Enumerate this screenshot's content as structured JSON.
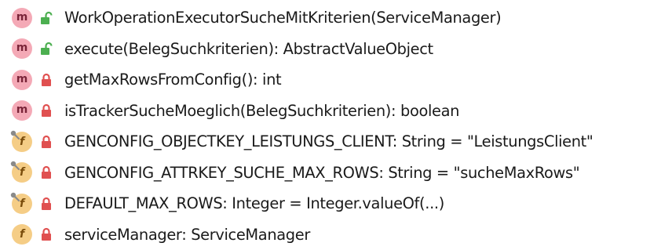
{
  "colors": {
    "method_badge": "#f4a9b6",
    "field_badge": "#f5cd86",
    "public_lock": "#4caf50",
    "private_lock": "#e05050",
    "static_pin": "#8a8a8a"
  },
  "members": [
    {
      "kind": "method",
      "kind_letter": "m",
      "visibility": "public",
      "static": false,
      "text": "WorkOperationExecutorSucheMitKriterien(ServiceManager)"
    },
    {
      "kind": "method",
      "kind_letter": "m",
      "visibility": "public",
      "static": false,
      "text": "execute(BelegSuchkriterien): AbstractValueObject"
    },
    {
      "kind": "method",
      "kind_letter": "m",
      "visibility": "private",
      "static": false,
      "text": "getMaxRowsFromConfig(): int"
    },
    {
      "kind": "method",
      "kind_letter": "m",
      "visibility": "private",
      "static": false,
      "text": "isTrackerSucheMoeglich(BelegSuchkriterien): boolean"
    },
    {
      "kind": "field",
      "kind_letter": "f",
      "visibility": "private",
      "static": true,
      "text": "GENCONFIG_OBJECTKEY_LEISTUNGS_CLIENT: String = \"LeistungsClient\""
    },
    {
      "kind": "field",
      "kind_letter": "f",
      "visibility": "private",
      "static": true,
      "text": "GENCONFIG_ATTRKEY_SUCHE_MAX_ROWS: String = \"sucheMaxRows\""
    },
    {
      "kind": "field",
      "kind_letter": "f",
      "visibility": "private",
      "static": true,
      "text": "DEFAULT_MAX_ROWS: Integer = Integer.valueOf(...)"
    },
    {
      "kind": "field",
      "kind_letter": "f",
      "visibility": "private",
      "static": false,
      "text": "serviceManager: ServiceManager"
    }
  ]
}
